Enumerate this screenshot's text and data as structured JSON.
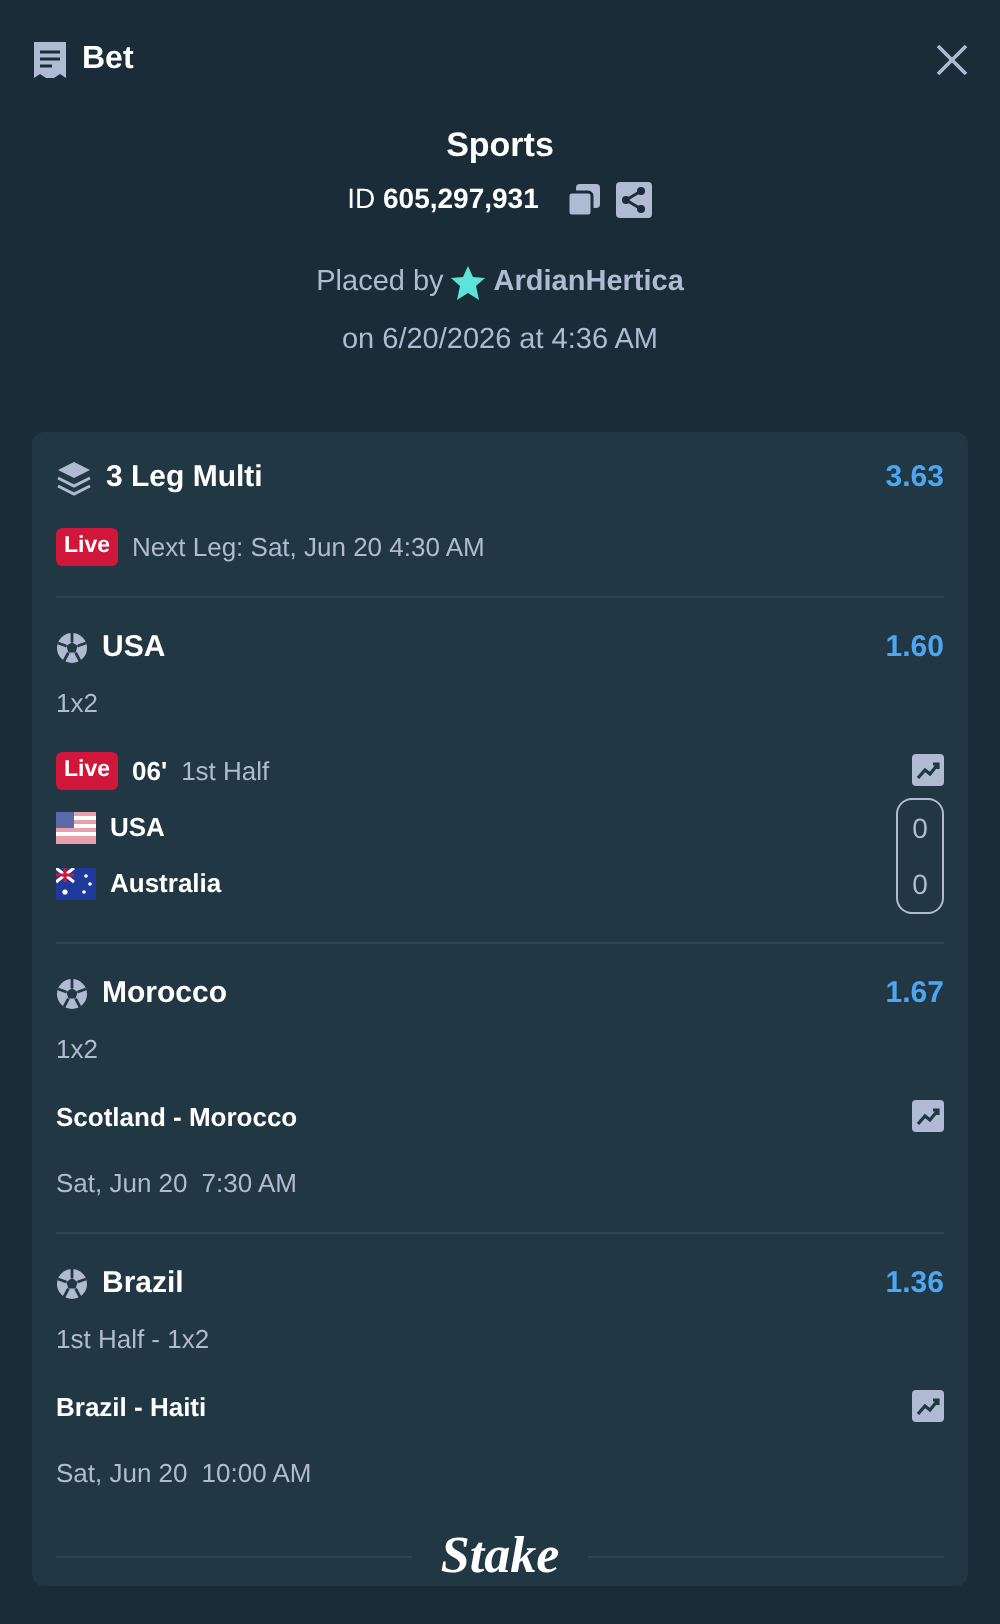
{
  "header": {
    "title": "Bet"
  },
  "summary": {
    "title": "Sports",
    "id_label": "ID",
    "id_value": "605,297,931",
    "placed_by": "Placed by",
    "user": "ArdianHertica",
    "placed_on": "on 6/20/2026 at 4:36 AM"
  },
  "multi": {
    "title": "3 Leg Multi",
    "odds": "3.63",
    "live_badge": "Live",
    "next_leg": "Next Leg: Sat, Jun 20 4:30 AM"
  },
  "legs": [
    {
      "kind": "live",
      "title": "USA",
      "odds": "1.60",
      "market": "1x2",
      "live_badge": "Live",
      "minute": "06'",
      "period": "1st Half",
      "teams": [
        {
          "name": "USA",
          "score": "0"
        },
        {
          "name": "Australia",
          "score": "0"
        }
      ]
    },
    {
      "kind": "scheduled",
      "title": "Morocco",
      "odds": "1.67",
      "market": "1x2",
      "match": "Scotland - Morocco",
      "date": "Sat, Jun 20",
      "time": "7:30 AM"
    },
    {
      "kind": "scheduled",
      "title": "Brazil",
      "odds": "1.36",
      "market": "1st Half - 1x2",
      "match": "Brazil - Haiti",
      "date": "Sat, Jun 20",
      "time": "10:00 AM"
    }
  ],
  "footer": {
    "logo": "Stake"
  }
}
